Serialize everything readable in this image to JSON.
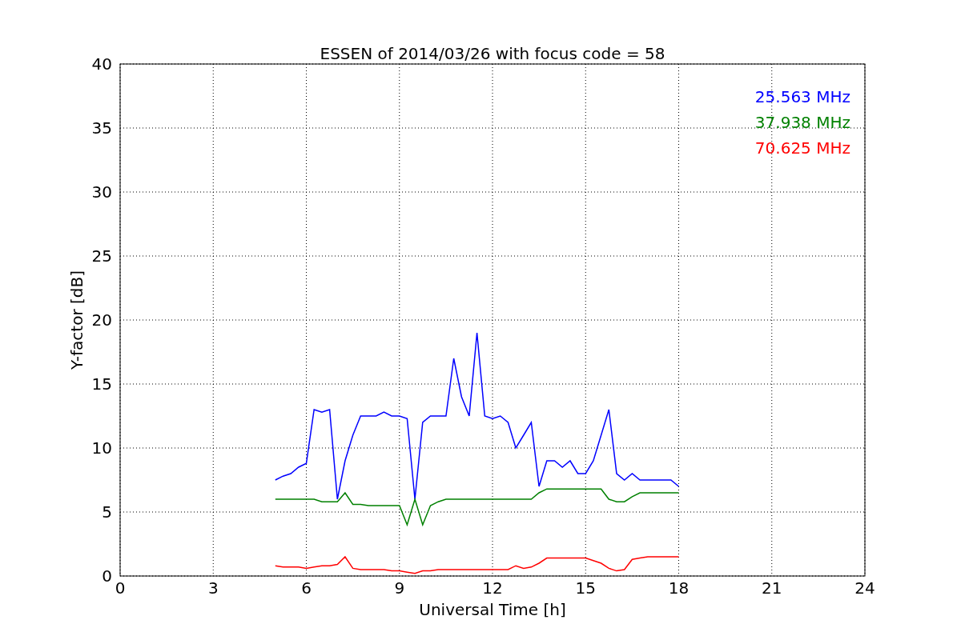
{
  "chart_data": {
    "type": "line",
    "title": "ESSEN of 2014/03/26 with focus code = 58",
    "xlabel": "Universal Time [h]",
    "ylabel": "Y-factor [dB]",
    "x": [
      5,
      5.25,
      5.5,
      5.75,
      6,
      6.25,
      6.5,
      6.75,
      7,
      7.25,
      7.5,
      7.75,
      8,
      8.25,
      8.5,
      8.75,
      9,
      9.25,
      9.5,
      9.75,
      10,
      10.25,
      10.5,
      10.75,
      11,
      11.25,
      11.5,
      11.75,
      12,
      12.25,
      12.5,
      12.75,
      13,
      13.25,
      13.5,
      13.75,
      14,
      14.25,
      14.5,
      14.75,
      15,
      15.25,
      15.5,
      15.75,
      16,
      16.25,
      16.5,
      16.75,
      17,
      17.25,
      17.5,
      17.75,
      18
    ],
    "series": [
      {
        "name": "25.563 MHz",
        "color": "#0000ff",
        "values": [
          7.5,
          7.8,
          8,
          8.5,
          8.8,
          13,
          12.8,
          13,
          6,
          9,
          11,
          12.5,
          12.5,
          12.5,
          12.8,
          12.5,
          12.5,
          12.3,
          6,
          12,
          12.5,
          12.5,
          12.5,
          17,
          14,
          12.5,
          19,
          12.5,
          12.3,
          12.5,
          12,
          10,
          11,
          12,
          7,
          9,
          9,
          8.5,
          9,
          8,
          8,
          9,
          11,
          13,
          8,
          7.5,
          8,
          7.5,
          7.5,
          7.5,
          7.5,
          7.5,
          7
        ]
      },
      {
        "name": "37.938 MHz",
        "color": "#008000",
        "values": [
          6,
          6,
          6,
          6,
          6,
          6,
          5.8,
          5.8,
          5.8,
          6.5,
          5.6,
          5.6,
          5.5,
          5.5,
          5.5,
          5.5,
          5.5,
          4,
          6,
          4,
          5.5,
          5.8,
          6,
          6,
          6,
          6,
          6,
          6,
          6,
          6,
          6,
          6,
          6,
          6,
          6.5,
          6.8,
          6.8,
          6.8,
          6.8,
          6.8,
          6.8,
          6.8,
          6.8,
          6,
          5.8,
          5.8,
          6.2,
          6.5,
          6.5,
          6.5,
          6.5,
          6.5,
          6.5
        ]
      },
      {
        "name": "70.625 MHz",
        "color": "#ff0000",
        "values": [
          0.8,
          0.7,
          0.7,
          0.7,
          0.6,
          0.7,
          0.8,
          0.8,
          0.9,
          1.5,
          0.6,
          0.5,
          0.5,
          0.5,
          0.5,
          0.4,
          0.4,
          0.3,
          0.2,
          0.4,
          0.4,
          0.5,
          0.5,
          0.5,
          0.5,
          0.5,
          0.5,
          0.5,
          0.5,
          0.5,
          0.5,
          0.8,
          0.6,
          0.7,
          1.0,
          1.4,
          1.4,
          1.4,
          1.4,
          1.4,
          1.4,
          1.2,
          1.0,
          0.6,
          0.4,
          0.5,
          1.3,
          1.4,
          1.5,
          1.5,
          1.5,
          1.5,
          1.5
        ]
      }
    ],
    "grid": true,
    "xlim": [
      0,
      24
    ],
    "ylim": [
      0,
      40
    ],
    "xticks": [
      0,
      3,
      6,
      9,
      12,
      15,
      18,
      21,
      24
    ],
    "yticks": [
      0,
      5,
      10,
      15,
      20,
      25,
      30,
      35,
      40
    ]
  }
}
